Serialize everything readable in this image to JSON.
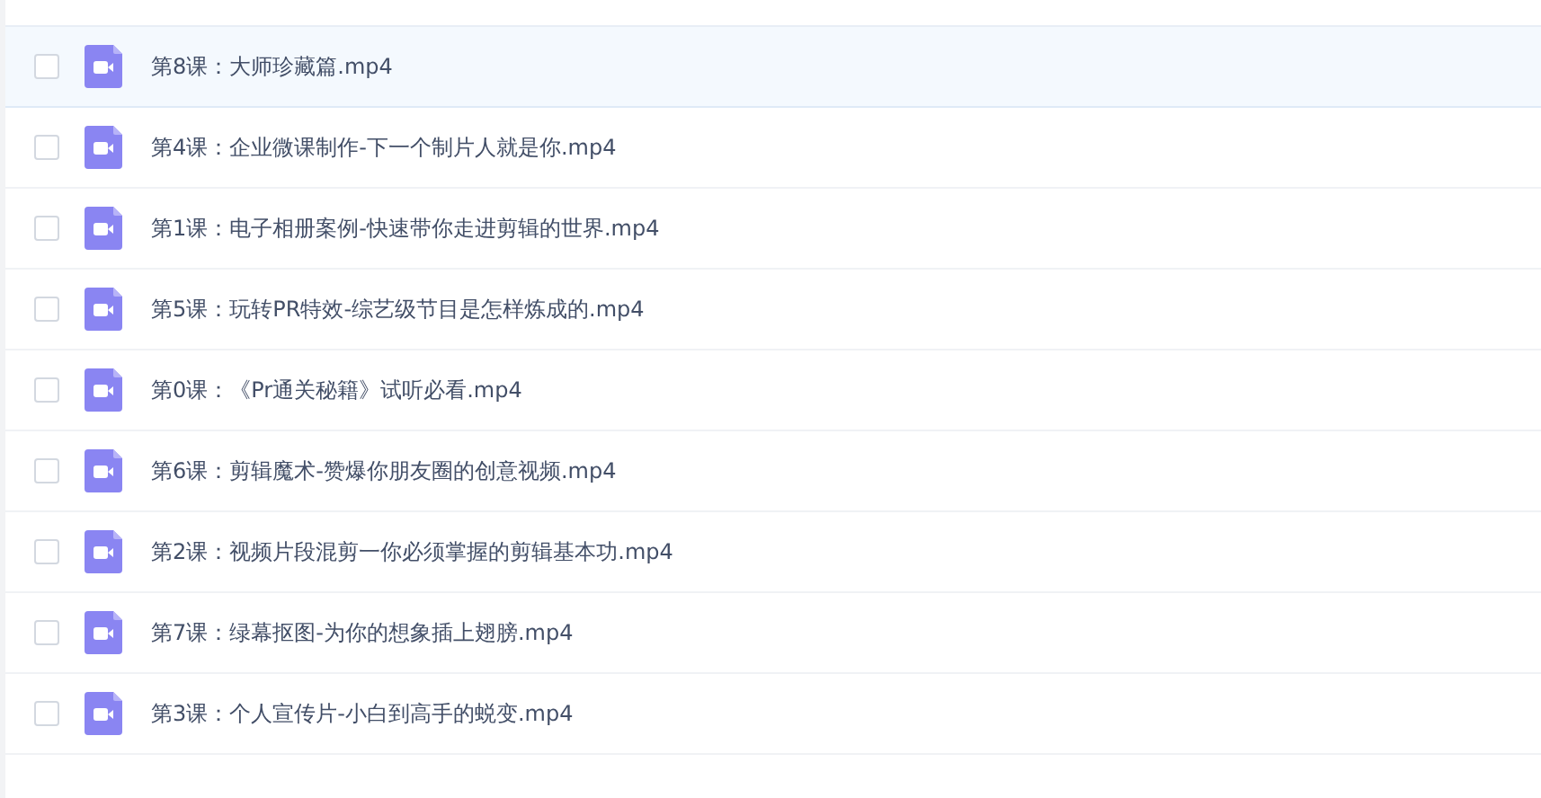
{
  "files": [
    {
      "name": "第8课：大师珍藏篇.mp4",
      "checked": false,
      "highlighted": true
    },
    {
      "name": "第4课：企业微课制作-下一个制片人就是你.mp4",
      "checked": false,
      "highlighted": false
    },
    {
      "name": "第1课：电子相册案例-快速带你走进剪辑的世界.mp4",
      "checked": false,
      "highlighted": false
    },
    {
      "name": "第5课：玩转PR特效-综艺级节目是怎样炼成的.mp4",
      "checked": false,
      "highlighted": false
    },
    {
      "name": "第0课：《Pr通关秘籍》试听必看.mp4",
      "checked": false,
      "highlighted": false
    },
    {
      "name": "第6课：剪辑魔术-赞爆你朋友圈的创意视频.mp4",
      "checked": false,
      "highlighted": false
    },
    {
      "name": "第2课：视频片段混剪一你必须掌握的剪辑基本功.mp4",
      "checked": false,
      "highlighted": false
    },
    {
      "name": "第7课：绿幕抠图-为你的想象插上翅膀.mp4",
      "checked": false,
      "highlighted": false
    },
    {
      "name": "第3课：个人宣传片-小白到高手的蜕变.mp4",
      "checked": false,
      "highlighted": false
    }
  ]
}
